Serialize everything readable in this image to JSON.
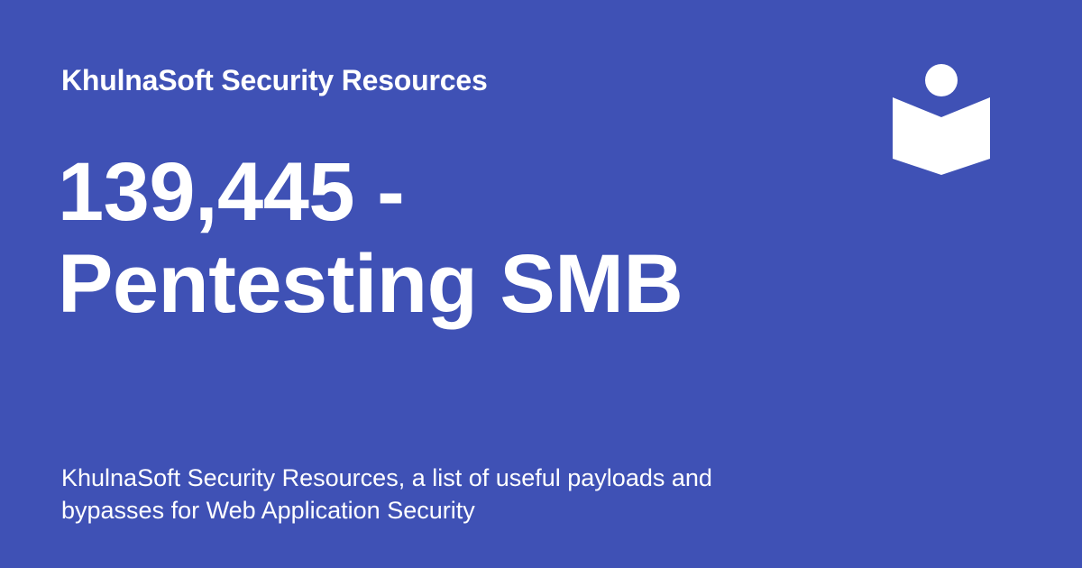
{
  "card": {
    "site_name": "KhulnaSoft Security Resources",
    "title_line1": "139,445 -",
    "title_line2": "Pentesting SMB",
    "description": "KhulnaSoft Security Resources, a list of useful payloads and bypasses for Web Application Security",
    "logo_icon": "reader-book-icon"
  },
  "colors": {
    "background": "#3f51b5",
    "text": "#ffffff"
  }
}
